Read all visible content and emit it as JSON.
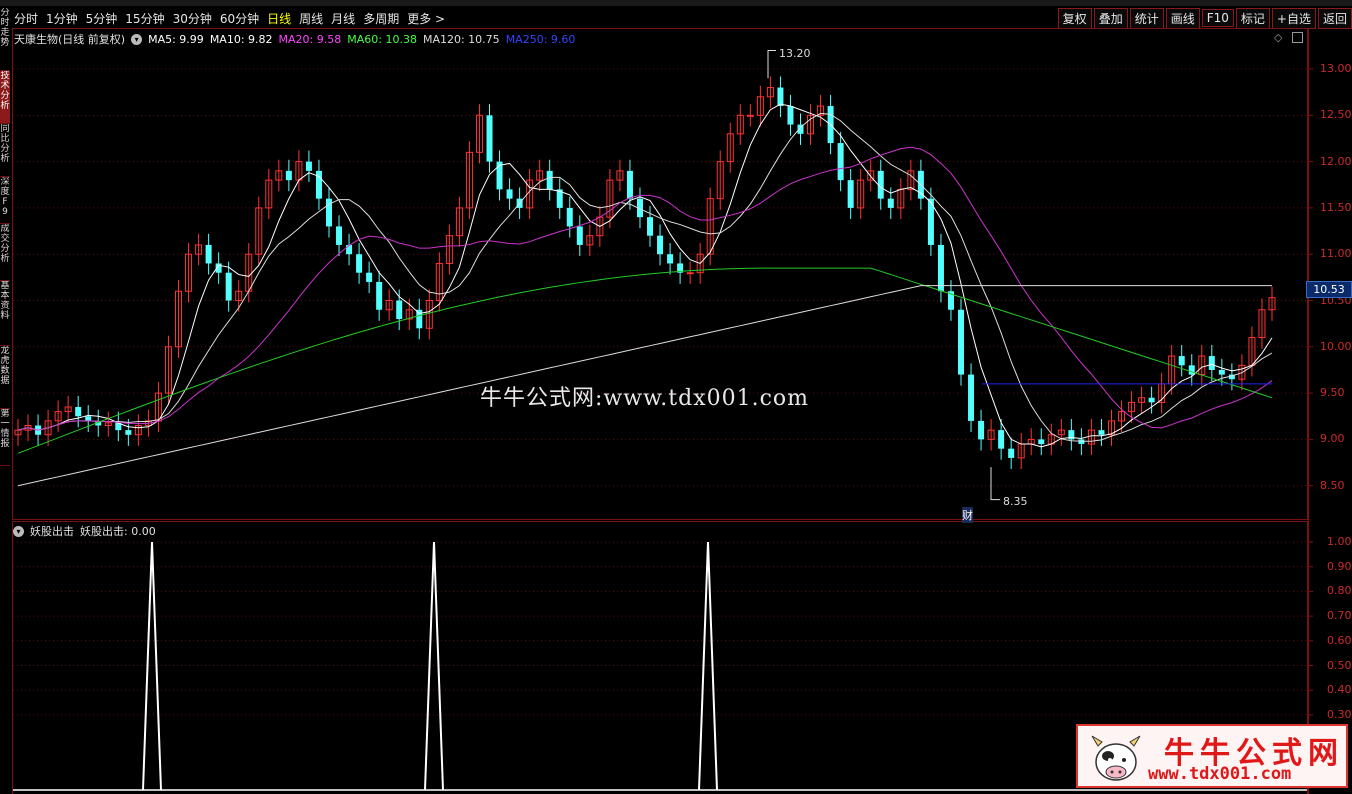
{
  "toolbar": {
    "periods": [
      "分时",
      "1分钟",
      "5分钟",
      "15分钟",
      "30分钟",
      "60分钟",
      "日线",
      "周线",
      "月线",
      "多周期",
      "更多 >"
    ],
    "active_period": "日线",
    "right_buttons": [
      "复权",
      "叠加",
      "统计",
      "画线",
      "F10",
      "标记",
      "+自选",
      "返回"
    ]
  },
  "left_tabs": [
    "分时走势",
    "技术分析",
    "同比分析",
    "深度F9",
    "成交分析",
    "基本资料",
    "龙虎数据",
    "第一情报"
  ],
  "main_chart": {
    "stock_name": "天康生物(日线 前复权)",
    "ma_legend": [
      {
        "label": "MA5: 9.99",
        "color": "#ffffff"
      },
      {
        "label": "MA10: 9.82",
        "color": "#ffffff"
      },
      {
        "label": "MA20: 9.58",
        "color": "#ff44ff"
      },
      {
        "label": "MA60: 10.38",
        "color": "#44ff44"
      },
      {
        "label": "MA120: 10.75",
        "color": "#dddddd"
      },
      {
        "label": "MA250: 9.60",
        "color": "#3344ff"
      }
    ],
    "high_label": "13.20",
    "low_label": "8.35",
    "event_marker": "财",
    "current_price": "10.53",
    "y_ticks": [
      "13.00",
      "12.50",
      "12.00",
      "11.50",
      "11.00",
      "10.50",
      "10.00",
      "9.50",
      "9.00",
      "8.50"
    ],
    "watermark": "牛牛公式网:www.tdx001.com"
  },
  "indicator": {
    "title": "妖股出击",
    "value_label": "妖股出击: 0.00",
    "y_ticks": [
      "1.00",
      "0.90",
      "0.80",
      "0.70",
      "0.60",
      "0.50",
      "0.40",
      "0.30"
    ]
  },
  "logo": {
    "title": "牛牛公式网",
    "url": "www.tdx001.com"
  },
  "colors": {
    "up": "#ff3232",
    "down": "#54ffff",
    "frame": "#7a1212",
    "ma20": "#cc33cc",
    "ma60": "#22cc22",
    "ma120": "#dddddd",
    "ma250": "#2222ee"
  }
}
